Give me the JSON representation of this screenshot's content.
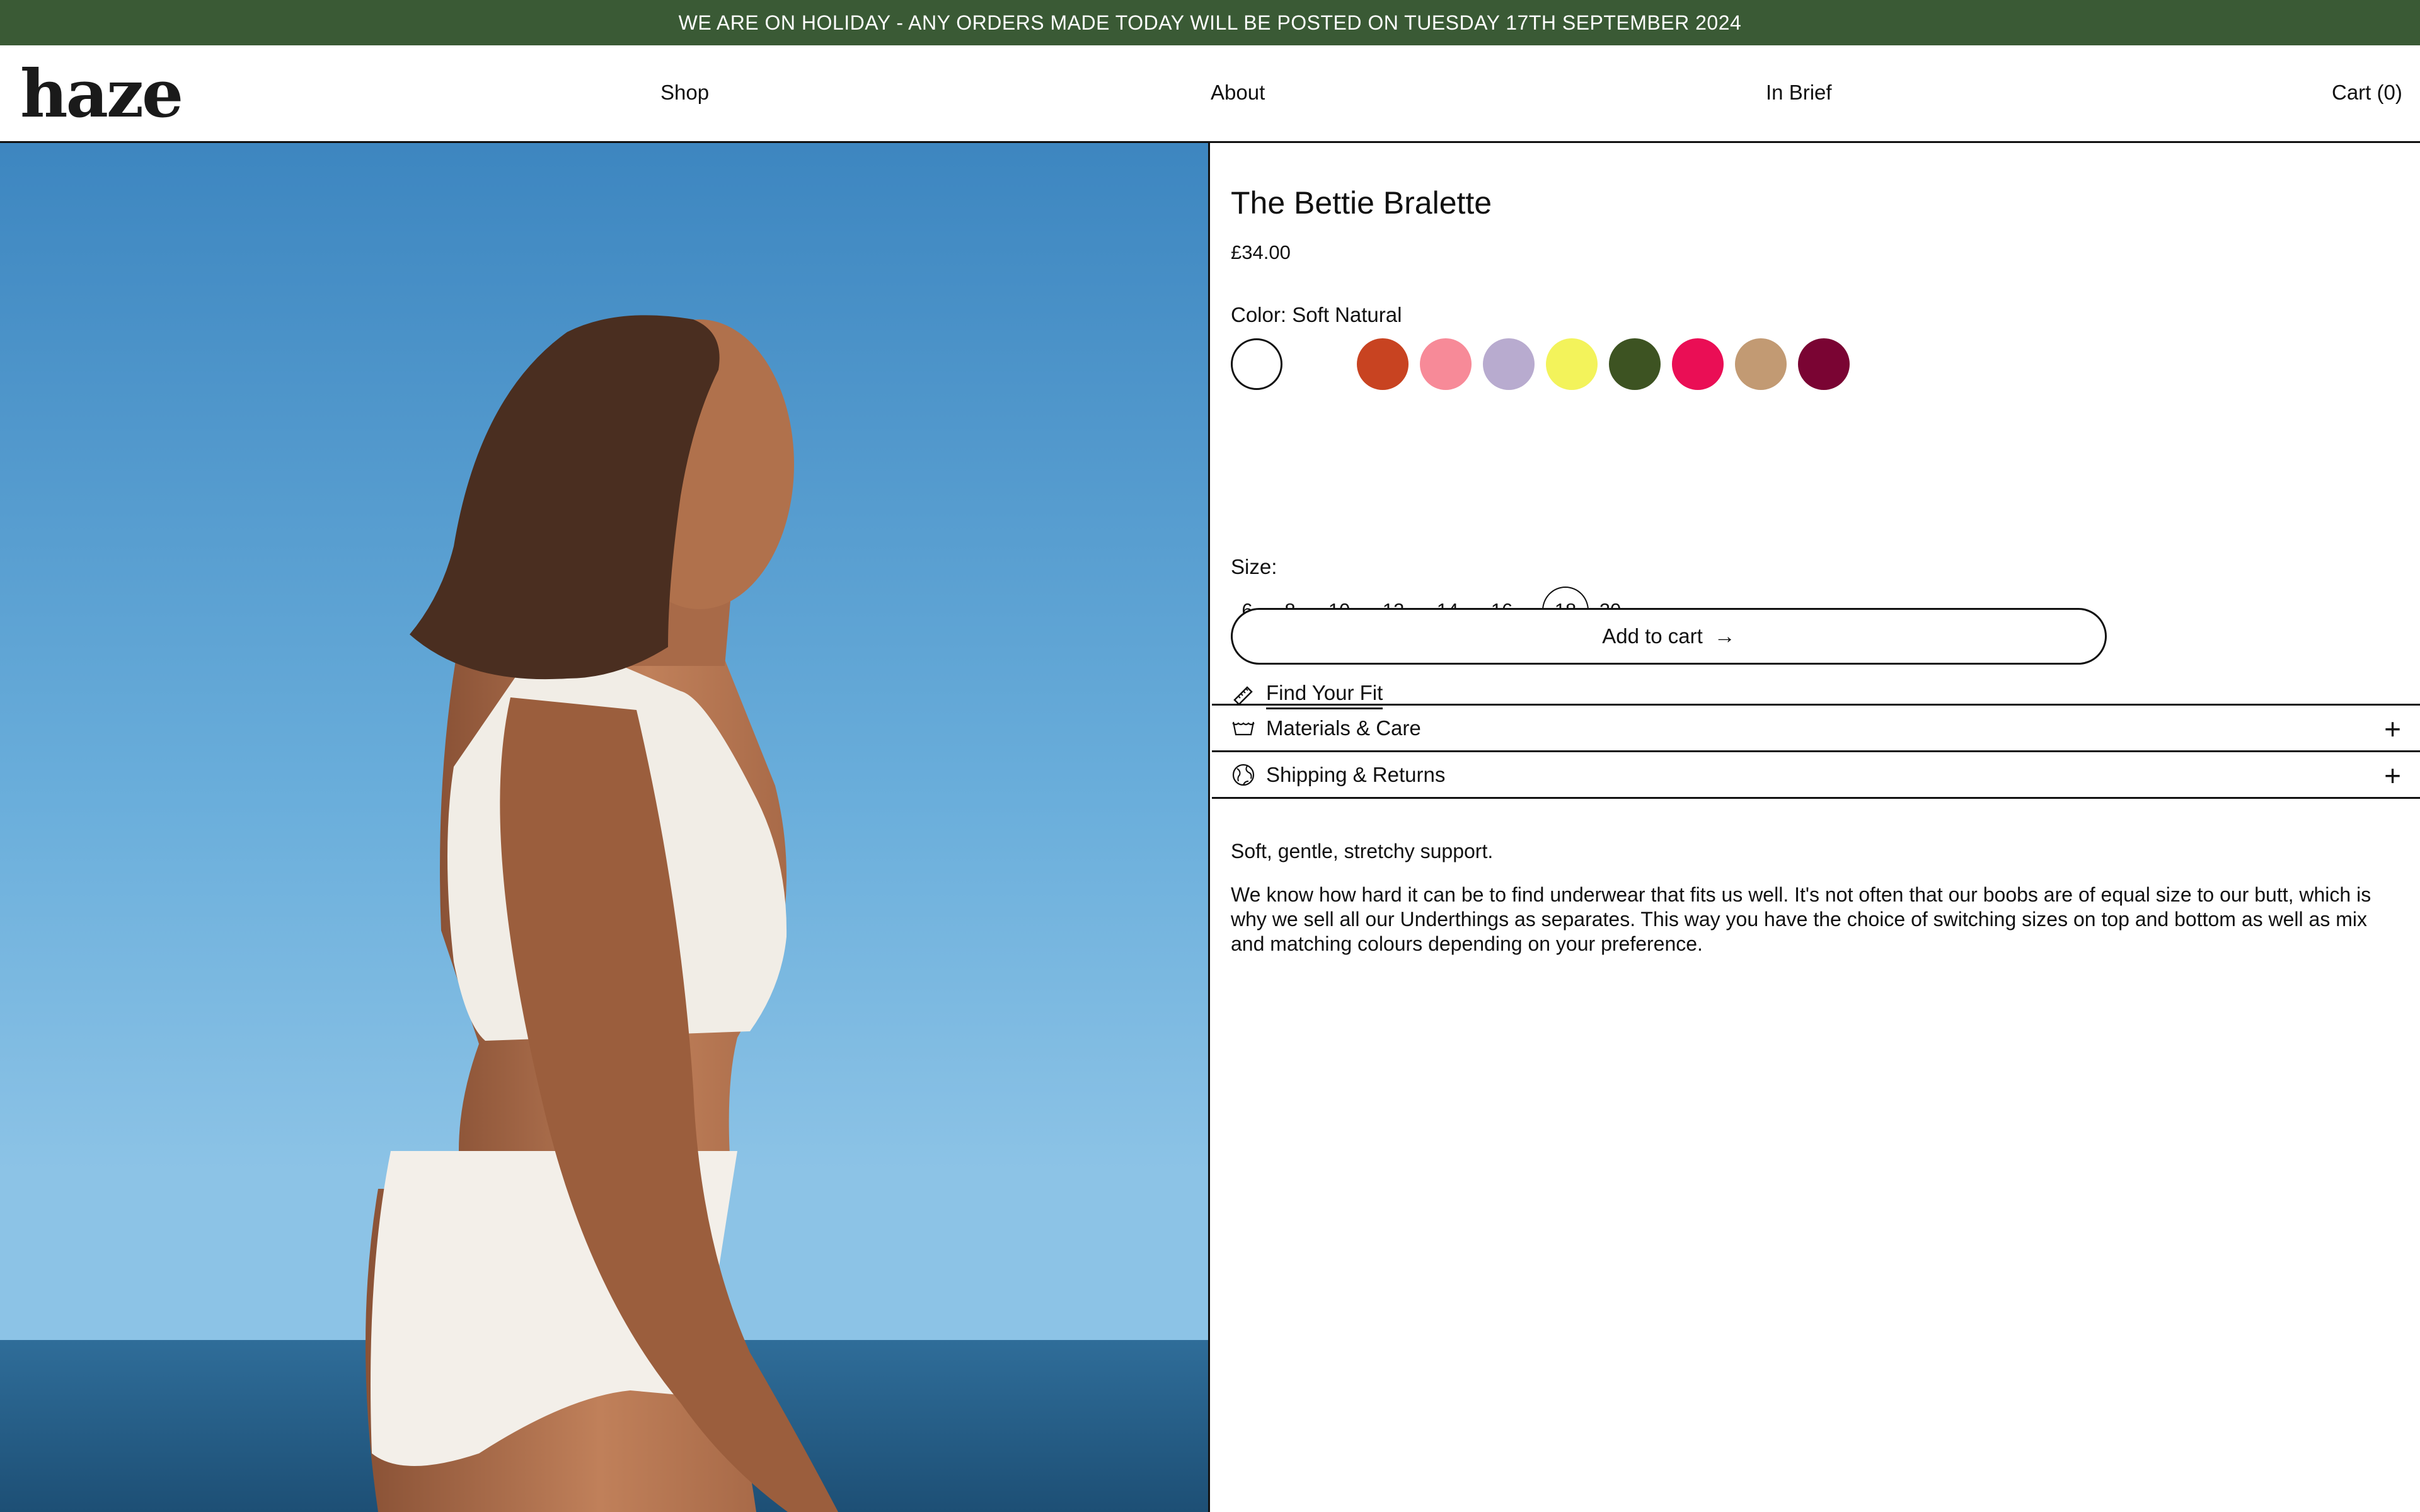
{
  "announcement": "WE ARE ON HOLIDAY - ANY ORDERS MADE TODAY WILL BE POSTED ON TUESDAY 17TH SEPTEMBER 2024",
  "header": {
    "logo": "haze",
    "nav": {
      "shop": "Shop",
      "about": "About",
      "in_brief": "In Brief",
      "cart": "Cart (0)"
    }
  },
  "product": {
    "title": "The Bettie Bralette",
    "price": "£34.00",
    "color_label": "Color: Soft Natural",
    "swatches": [
      {
        "name": "Soft Natural",
        "color": "#ffffff",
        "selected": true
      },
      {
        "name": "White",
        "color": "#ffffff"
      },
      {
        "name": "Rust",
        "color": "#c84321"
      },
      {
        "name": "Pink",
        "color": "#f78a98"
      },
      {
        "name": "Lilac",
        "color": "#b8abcf"
      },
      {
        "name": "Lime",
        "color": "#f3f35b"
      },
      {
        "name": "Olive",
        "color": "#3d5322"
      },
      {
        "name": "Magenta",
        "color": "#ea0e55"
      },
      {
        "name": "Tan",
        "color": "#c29a73"
      },
      {
        "name": "Burgundy",
        "color": "#7a0433"
      }
    ],
    "size_label": "Size:",
    "sizes": [
      "6",
      "8",
      "10",
      "12",
      "14",
      "16",
      "18",
      "20"
    ],
    "selected_size": "18",
    "find_fit": "Find Your Fit",
    "add_to_cart": "Add to cart",
    "add_to_cart_arrow": "→",
    "accordions": {
      "materials": "Materials & Care",
      "shipping": "Shipping & Returns",
      "expand_symbol": "+"
    },
    "description": {
      "p1": "Soft, gentle, stretchy support.",
      "p2": "We know how hard it can be to find underwear that fits us well. It's not often that our boobs are of equal size to our butt, which is why we sell all our Underthings as separates. This way you have the choice of switching sizes on top and bottom as well as mix and matching colours depending on your preference."
    }
  },
  "colors": {
    "announcement_bg": "#3a5a35",
    "text": "#111111"
  }
}
